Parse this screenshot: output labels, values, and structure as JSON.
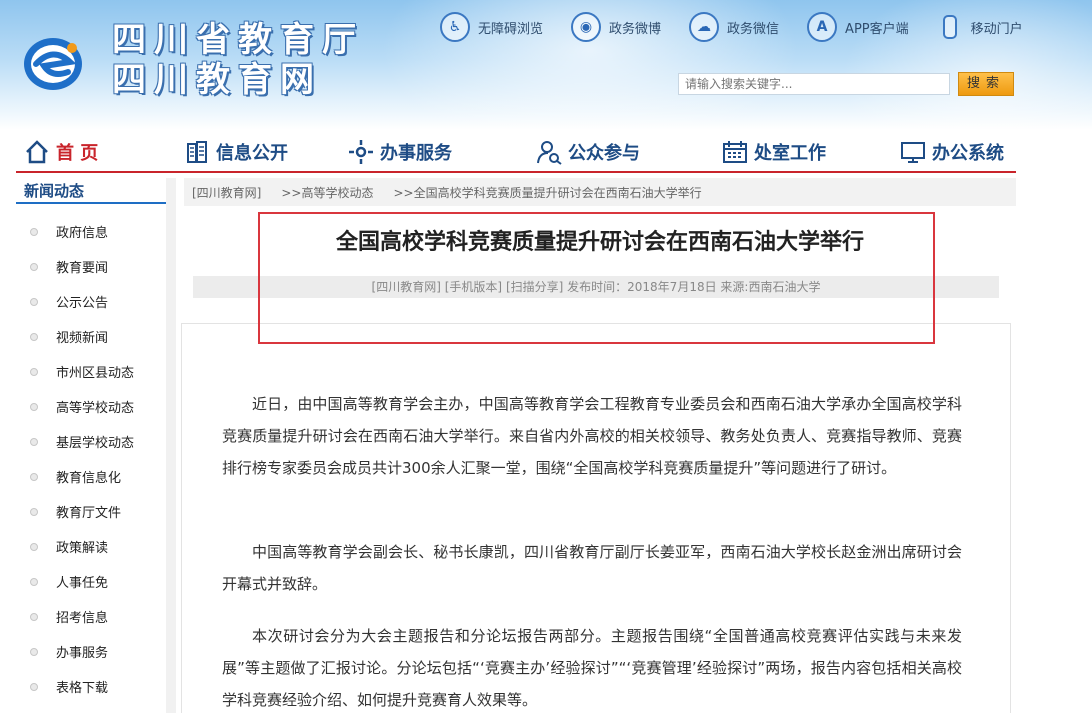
{
  "header": {
    "title_line1": "四川省教育厅",
    "title_line2": "四川教育网",
    "quick_links": [
      {
        "label": "无障碍浏览",
        "icon": "accessibility-icon"
      },
      {
        "label": "政务微博",
        "icon": "weibo-icon"
      },
      {
        "label": "政务微信",
        "icon": "wechat-icon"
      },
      {
        "label": "APP客户端",
        "icon": "app-store-icon"
      },
      {
        "label": "移动门户",
        "icon": "mobile-phone-icon"
      }
    ],
    "search": {
      "placeholder": "请输入搜索关键字...",
      "button": "搜索"
    }
  },
  "nav": {
    "items": [
      {
        "label": "首 页",
        "icon": "home-icon"
      },
      {
        "label": "信息公开",
        "icon": "building-icon"
      },
      {
        "label": "办事服务",
        "icon": "gear-icon"
      },
      {
        "label": "公众参与",
        "icon": "user-search-icon"
      },
      {
        "label": "处室工作",
        "icon": "calendar-icon"
      },
      {
        "label": "办公系统",
        "icon": "monitor-icon"
      }
    ]
  },
  "sidebar": {
    "title": "新闻动态",
    "items": [
      "政府信息",
      "教育要闻",
      "公示公告",
      "视频新闻",
      "市州区县动态",
      "高等学校动态",
      "基层学校动态",
      "教育信息化",
      "教育厅文件",
      "政策解读",
      "人事任免",
      "招考信息",
      "办事服务",
      "表格下载"
    ]
  },
  "breadcrumb": [
    "[四川教育网]",
    ">>高等学校动态",
    ">>全国高校学科竞赛质量提升研讨会在西南石油大学举行"
  ],
  "article": {
    "title": "全国高校学科竞赛质量提升研讨会在西南石油大学举行",
    "meta": {
      "site": "[四川教育网]",
      "mobile": "[手机版本]",
      "share": "[扫描分享]",
      "published": "发布时间：2018年7月18日",
      "source": "来源:西南石油大学"
    },
    "paragraphs": [
      "近日，由中国高等教育学会主办，中国高等教育学会工程教育专业委员会和西南石油大学承办全国高校学科竞赛质量提升研讨会在西南石油大学举行。来自省内外高校的相关校领导、教务处负责人、竞赛指导教师、竞赛排行榜专家委员会成员共计300余人汇聚一堂，围绕“全国高校学科竞赛质量提升”等问题进行了研讨。",
      "中国高等教育学会副会长、秘书长康凯，四川省教育厅副厅长姜亚军，西南石油大学校长赵金洲出席研讨会开幕式并致辞。",
      "本次研讨会分为大会主题报告和分论坛报告两部分。主题报告围绕“全国普通高校竞赛评估实践与未来发展”等主题做了汇报讨论。分论坛包括“‘竞赛主办’经验探讨”“‘竞赛管理’经验探讨”两场，报告内容包括相关高校学科竞赛经验介绍、如何提升竞赛育人效果等。"
    ]
  },
  "colors": {
    "accent_red": "#c9242b",
    "nav_blue": "#1e4c85",
    "search_button": "#f0a21a"
  }
}
